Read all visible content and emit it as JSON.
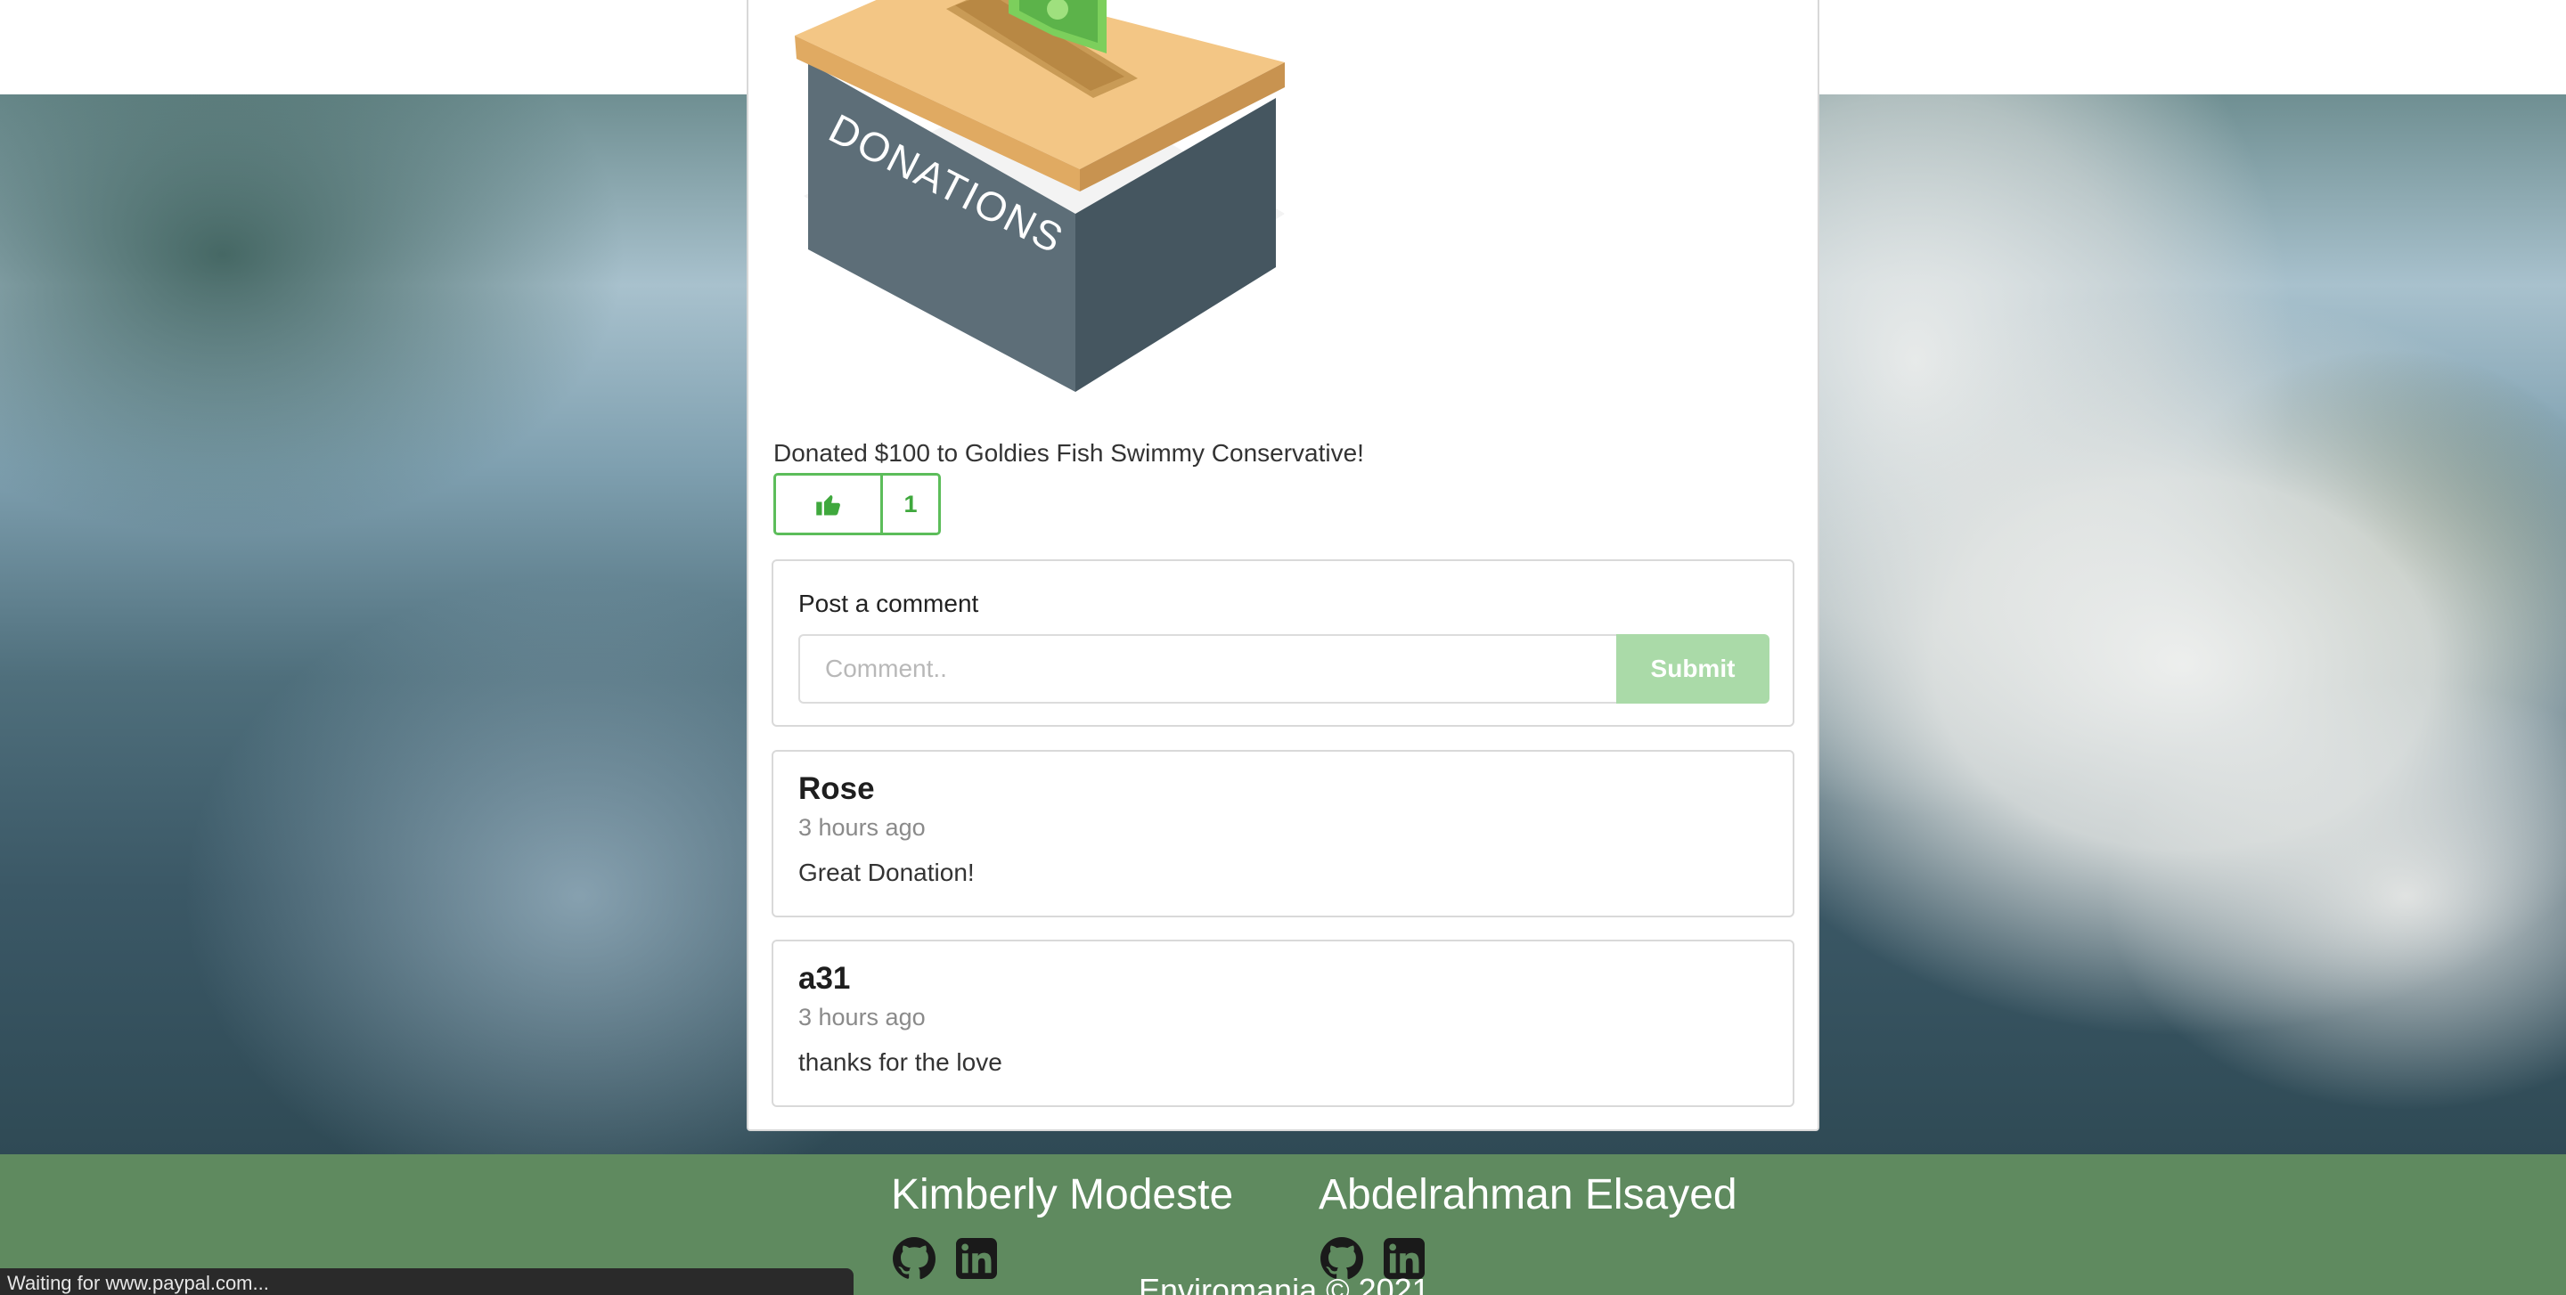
{
  "post": {
    "image_label": "DONATIONS",
    "text": "Donated $100 to Goldies Fish Swimmy Conservative!",
    "likes": "1"
  },
  "comment_form": {
    "label": "Post a comment",
    "placeholder": "Comment..",
    "submit_label": "Submit"
  },
  "comments": [
    {
      "author": "Rose",
      "time": "3 hours ago",
      "body": "Great Donation!"
    },
    {
      "author": "a31",
      "time": "3 hours ago",
      "body": "thanks for the love"
    }
  ],
  "footer": {
    "authors": [
      {
        "name": "Kimberly Modeste"
      },
      {
        "name": "Abdelrahman Elsayed"
      }
    ],
    "copyright": "Enviromania © 2021"
  },
  "status_bar": {
    "text": "Waiting for www.paypal.com..."
  },
  "colors": {
    "accent_green": "#5cbd5a",
    "footer_green": "#5f8a5f",
    "submit_disabled": "#aadaa8"
  }
}
